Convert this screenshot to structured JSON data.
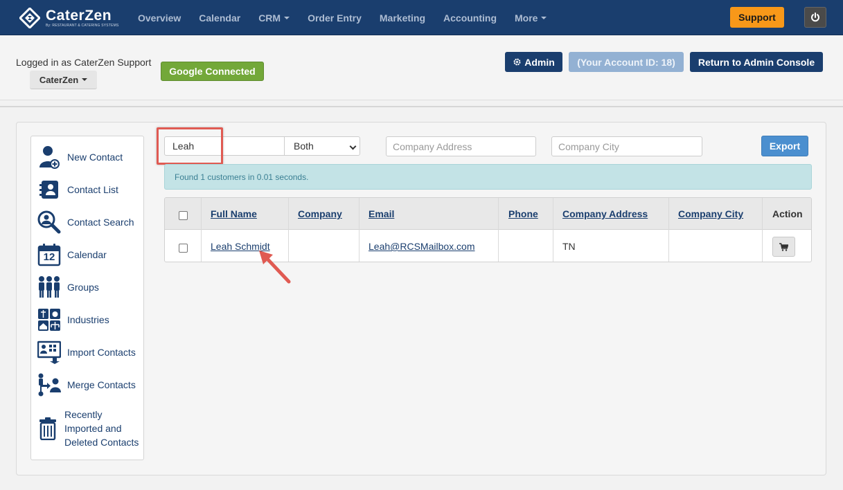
{
  "brand": {
    "name": "CaterZen",
    "tagline": "By: RESTAURANT & CATERING SYSTEMS"
  },
  "nav": {
    "items": [
      {
        "label": "Overview"
      },
      {
        "label": "Calendar"
      },
      {
        "label": "CRM",
        "dropdown": true
      },
      {
        "label": "Order Entry"
      },
      {
        "label": "Marketing"
      },
      {
        "label": "Accounting"
      },
      {
        "label": "More",
        "dropdown": true
      }
    ],
    "support_label": "Support",
    "power_icon": "power-icon"
  },
  "account": {
    "logged_in_text": "Logged in as CaterZen Support",
    "location_dropdown": "CaterZen",
    "google_status": "Google Connected",
    "admin_label": "Admin",
    "account_id_label": "(Your Account ID: 18)",
    "return_label": "Return to Admin Console"
  },
  "sidebar": {
    "items": [
      {
        "label": "New Contact",
        "icon": "new-contact-icon"
      },
      {
        "label": "Contact List",
        "icon": "contact-list-icon"
      },
      {
        "label": "Contact Search",
        "icon": "contact-search-icon"
      },
      {
        "label": "Calendar",
        "icon": "calendar-icon",
        "icon_text": "12"
      },
      {
        "label": "Groups",
        "icon": "groups-icon"
      },
      {
        "label": "Industries",
        "icon": "industries-icon"
      },
      {
        "label": "Import Contacts",
        "icon": "import-contacts-icon"
      },
      {
        "label": "Merge Contacts",
        "icon": "merge-contacts-icon"
      },
      {
        "label_lines": [
          "Recently",
          "Imported and",
          "Deleted Contacts"
        ],
        "icon": "trash-icon"
      }
    ]
  },
  "filters": {
    "name_value": "Leah",
    "match_select": "Both",
    "company_address_placeholder": "Company Address",
    "company_city_placeholder": "Company City",
    "export_label": "Export"
  },
  "results": {
    "summary": "Found 1 customers in 0.01 seconds.",
    "columns": [
      "Full Name",
      "Company",
      "Email",
      "Phone",
      "Company Address",
      "Company City",
      "Action"
    ],
    "rows": [
      {
        "full_name": "Leah Schmidt",
        "company": "",
        "email": "Leah@RCSMailbox.com",
        "phone": "",
        "company_address": "TN",
        "company_city": "",
        "action_icon": "cart-icon"
      }
    ]
  },
  "colors": {
    "nav_bg": "#1a3e6e",
    "support": "#f89819",
    "google": "#73a839",
    "export": "#4b8fcf",
    "alert_bg": "#c3e3e6",
    "annotation": "#e05a52"
  }
}
